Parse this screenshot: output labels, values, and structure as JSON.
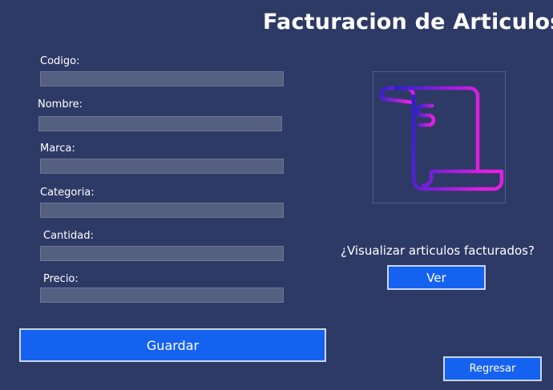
{
  "header": {
    "title": "Facturacion de Articulos"
  },
  "form": {
    "codigo": {
      "label": "Codigo:",
      "value": ""
    },
    "nombre": {
      "label": "Nombre:",
      "value": ""
    },
    "marca": {
      "label": "Marca:",
      "value": ""
    },
    "categoria": {
      "label": "Categoria:",
      "value": ""
    },
    "cantidad": {
      "label": "Cantidad:",
      "value": ""
    },
    "precio": {
      "label": "Precio:",
      "value": ""
    },
    "save_label": "Guardar"
  },
  "side": {
    "question": "¿Visualizar articulos facturados?",
    "view_label": "Ver",
    "image_icon": "invoice-receipt-icon"
  },
  "footer": {
    "back_label": "Regresar"
  },
  "colors": {
    "background": "#2e3a66",
    "button": "#1662f0",
    "field": "#555f80",
    "icon_gradient_start": "#2a1fd0",
    "icon_gradient_end": "#e21fe0"
  }
}
